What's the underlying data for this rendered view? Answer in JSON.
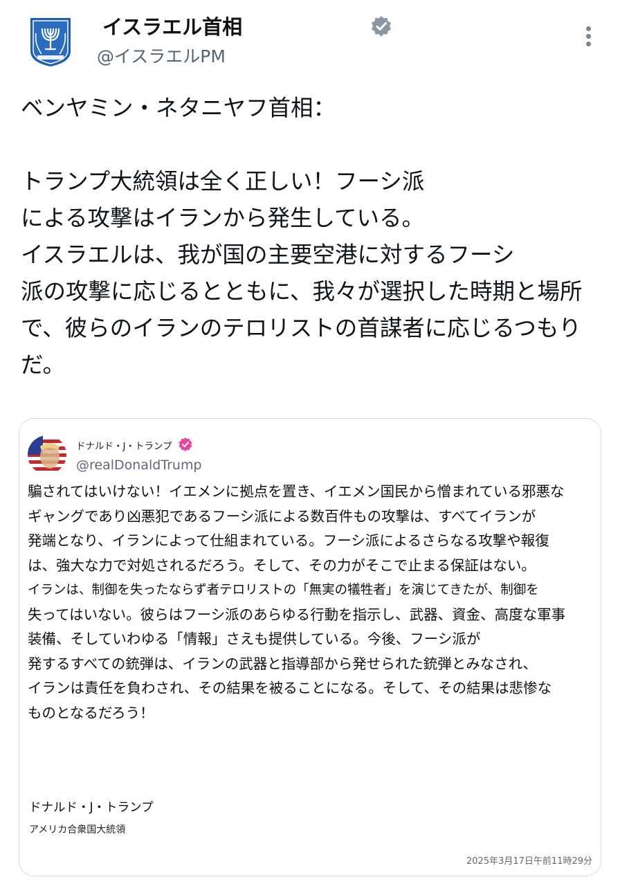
{
  "author": {
    "name": "イスラエル首相",
    "handle": "@イスラエルPM",
    "icon": "israel-emblem-menorah",
    "verified_icon": "verified-badge-icon"
  },
  "post": {
    "line1": "ベンヤミン・ネタニヤフ首相：",
    "line2": "トランプ大統領は全く正しい！フーシ派",
    "line3": "による攻撃はイランから発生している。",
    "line4": "イスラエルは、我が国の主要空港に対するフーシ",
    "line5": "派の攻撃に応じるとともに、我々が選択した時期と場所",
    "line6": "で、彼らのイランのテロリストの首謀者に応じるつもり",
    "line7": "だ。"
  },
  "quote": {
    "name": "ドナルド・J・トランプ",
    "handle": "@realDonaldTrump",
    "lines": [
      "騙されてはいけない！イエメンに拠点を置き、イエメン国民から憎まれている邪悪な",
      "ギャングであり凶悪犯であるフーシ派による数百件もの攻撃は、すべてイランが",
      "発端となり、イランによって仕組まれている。フーシ派によるさらなる攻撃や報復",
      "は、強大な力で対処されるだろう。そして、その力がそこで止まる保証はない。",
      "イランは、制御を失ったならず者テロリストの「無実の犠牲者」を演じてきたが、制御を",
      "失ってはいない。彼らはフーシ派のあらゆる行動を指示し、武器、資金、高度な軍事",
      "装備、そしていわゆる「情報」さえも提供している。今後、フーシ派が",
      "発するすべての銃弾は、イランの武器と指導部から発せられた銃弾とみなされ、",
      "イランは責任を負わされ、その結果を被ることになる。そして、その結果は悲惨な",
      "ものとなるだろう！"
    ],
    "signature_name": "ドナルド・J・トランプ",
    "signature_title": "アメリカ合衆国大統領",
    "timestamp": "2025年3月17日午前11時29分"
  },
  "colors": {
    "verified_gray": "#8a96a3",
    "verified_pink": "#e6479a",
    "emblem_blue": "#1f5fae"
  }
}
